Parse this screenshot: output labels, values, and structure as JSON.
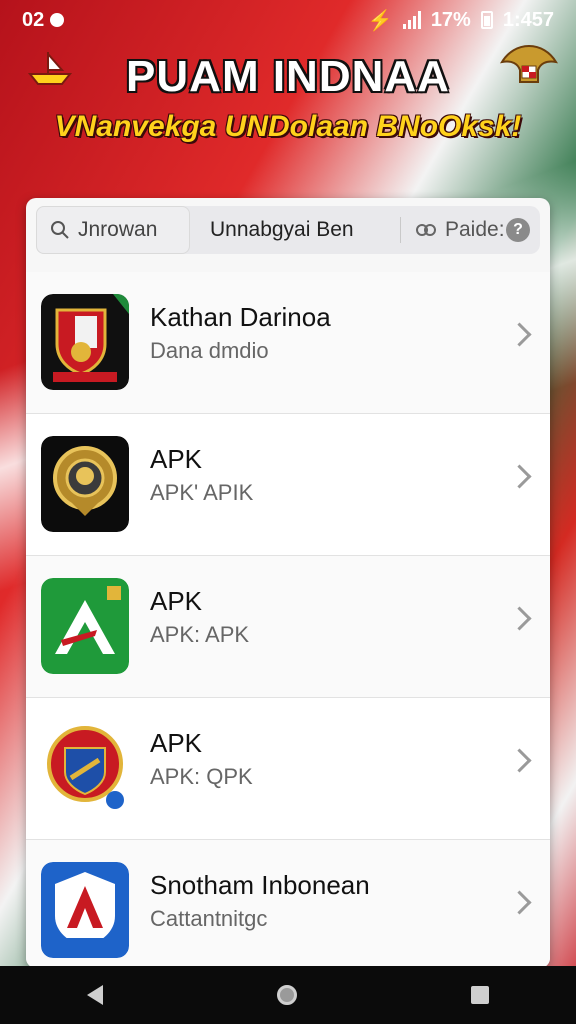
{
  "status_bar": {
    "left_text": "02",
    "battery_text": "17%",
    "time": "1:457"
  },
  "header": {
    "title": "PUAM INDNAA",
    "subtitle": "VNanvekga UNDolaan BNoOksk!"
  },
  "tabs": {
    "search_label": "Jnrowan",
    "middle_label": "Unnabgyai Ben",
    "right_label": "Paide:",
    "help_label": "?"
  },
  "apps": [
    {
      "title": "Kathan Darinoa",
      "subtitle": "Dana dmdio",
      "icon": "shield-crest-icon"
    },
    {
      "title": "APK",
      "subtitle": "APK' APIK",
      "icon": "gold-emblem-icon"
    },
    {
      "title": "APK",
      "subtitle": "APK: APK",
      "icon": "green-a-logo-icon"
    },
    {
      "title": "APK",
      "subtitle": "APK: QPK",
      "icon": "badge-seal-icon"
    },
    {
      "title": "Snotham Inbonean",
      "subtitle": "Cattantnitgc",
      "icon": "blue-a-logo-icon"
    }
  ],
  "icons": {
    "colors": {
      "red": "#c81a22",
      "green": "#1f8a3a",
      "gold": "#e2b53a",
      "blue": "#1e63c9"
    }
  }
}
